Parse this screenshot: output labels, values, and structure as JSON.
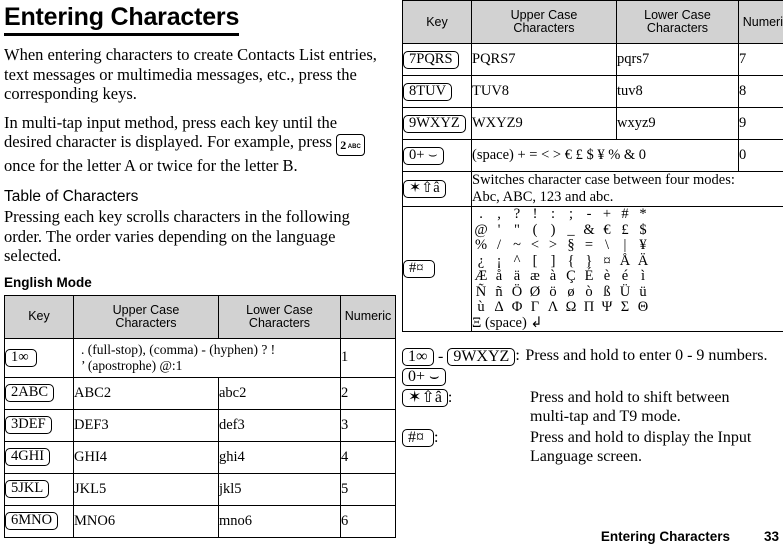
{
  "document": {
    "title": "Entering Characters",
    "intro_paragraph_1": "When entering characters to create Contacts List entries, text messages or multimedia messages, etc., press the corresponding keys.",
    "intro_paragraph_2a": "In multi-tap input method, press each key until the desired character is displayed. For example, press",
    "intro_paragraph_2b": "once for the letter A or twice for the letter B.",
    "inline_key": {
      "num": "2",
      "label": "ABC",
      "icon": "key-2-abc-icon"
    },
    "section_heading": "Table of Characters",
    "section_body": "Pressing each key scrolls characters in the following order. The order varies depending on the language selected.",
    "mode_heading": "English Mode"
  },
  "table": {
    "headers": {
      "key": "Key",
      "upper": "Upper Case Characters",
      "upper_line1": "Upper Case",
      "upper_line2": "Characters",
      "lower_line1": "Lower Case",
      "lower_line2": "Characters",
      "numeric": "Numeric"
    },
    "header_bg": "#d2d2d2",
    "left_rows": [
      {
        "key": {
          "num": "1",
          "label": "∞",
          "icon": "key-1-icon"
        },
        "upper_line1": ". (full-stop), (comma) - (hyphen) ? !",
        "upper_line2": "’ (apostrophe) @:1",
        "spans_upper_lower": true,
        "numeric": "1"
      },
      {
        "key": {
          "num": "2",
          "label": "ABC",
          "icon": "key-2-abc-icon"
        },
        "upper": "ABC2",
        "lower": "abc2",
        "numeric": "2"
      },
      {
        "key": {
          "num": "3",
          "label": "DEF",
          "icon": "key-3-def-icon"
        },
        "upper": "DEF3",
        "lower": "def3",
        "numeric": "3"
      },
      {
        "key": {
          "num": "4",
          "label": "GHI",
          "icon": "key-4-ghi-icon"
        },
        "upper": "GHI4",
        "lower": "ghi4",
        "numeric": "4"
      },
      {
        "key": {
          "num": "5",
          "label": "JKL",
          "icon": "key-5-jkl-icon"
        },
        "upper": "JKL5",
        "lower": "jkl5",
        "numeric": "5"
      },
      {
        "key": {
          "num": "6",
          "label": "MNO",
          "icon": "key-6-mno-icon"
        },
        "upper": "MNO6",
        "lower": "mno6",
        "numeric": "6"
      }
    ],
    "right_rows": [
      {
        "key": {
          "num": "7",
          "label": "PQRS",
          "icon": "key-7-pqrs-icon"
        },
        "upper": "PQRS7",
        "lower": "pqrs7",
        "numeric": "7"
      },
      {
        "key": {
          "num": "8",
          "label": "TUV",
          "icon": "key-8-tuv-icon"
        },
        "upper": "TUV8",
        "lower": "tuv8",
        "numeric": "8"
      },
      {
        "key": {
          "num": "9",
          "label": "WXYZ",
          "icon": "key-9-wxyz-icon"
        },
        "upper": "WXYZ9",
        "lower": "wxyz9",
        "numeric": "9"
      },
      {
        "key": {
          "num": "0",
          "label": "+ ⌣",
          "icon": "key-0-icon"
        },
        "upper": "(space) + = < > € £ $ ¥ % & 0",
        "spans_upper_lower": true,
        "numeric": "0"
      }
    ],
    "star_row": {
      "key": {
        "num": "✶",
        "label": "⇧â",
        "icon": "key-star-icon"
      },
      "desc_line1": "Switches character case between four modes:",
      "desc_line2": "Abc, ABC, 123 and abc."
    },
    "hash_row": {
      "key": {
        "num": "#",
        "label": "¤",
        "icon": "key-hash-icon"
      },
      "special_grid": [
        [
          ".",
          ",",
          "?",
          "!",
          ":",
          ";",
          "-",
          "+",
          "#",
          "*"
        ],
        [
          "@",
          "'",
          "\"",
          "(",
          ")",
          "_",
          "&",
          "€",
          "£",
          "$"
        ],
        [
          "%",
          "/",
          "~",
          "<",
          ">",
          "§",
          "=",
          "\\",
          "|",
          "¥"
        ],
        [
          "¿",
          "¡",
          "^",
          "[",
          "]",
          "{",
          "}",
          "¤",
          "Å",
          "Ä"
        ],
        [
          "Æ",
          "å",
          "ä",
          "æ",
          "à",
          "Ç",
          "É",
          "è",
          "é",
          "ì"
        ],
        [
          "Ñ",
          "ñ",
          "Ö",
          "Ø",
          "ö",
          "ø",
          "ò",
          "ß",
          "Ü",
          "ü"
        ],
        [
          "ù",
          "Δ",
          "Φ",
          "Γ",
          "Λ",
          "Ω",
          "Π",
          "Ψ",
          "Σ",
          "Θ"
        ]
      ],
      "special_tail": "Ξ (space) ↲"
    }
  },
  "legend": {
    "row1": {
      "key_from": {
        "num": "1",
        "label": "∞",
        "icon": "key-1-icon"
      },
      "dash": "-",
      "key_to": {
        "num": "9",
        "label": "WXYZ",
        "icon": "key-9-wxyz-icon"
      },
      "key_zero": {
        "num": "0",
        "label": "+ ⌣",
        "icon": "key-0-icon"
      },
      "colon": ":",
      "text": "Press and hold to enter 0 - 9 numbers."
    },
    "row2": {
      "key": {
        "num": "✶",
        "label": "⇧â",
        "icon": "key-star-icon"
      },
      "colon": ":",
      "text_line1": "Press and hold to shift between",
      "text_line2": "multi-tap and T9 mode."
    },
    "row3": {
      "key": {
        "num": "#",
        "label": "¤",
        "icon": "key-hash-icon"
      },
      "colon": ":",
      "text_line1": "Press and hold to display the Input",
      "text_line2": "Language screen."
    }
  },
  "footer": {
    "chapter": "Entering Characters",
    "page_number": "33"
  }
}
